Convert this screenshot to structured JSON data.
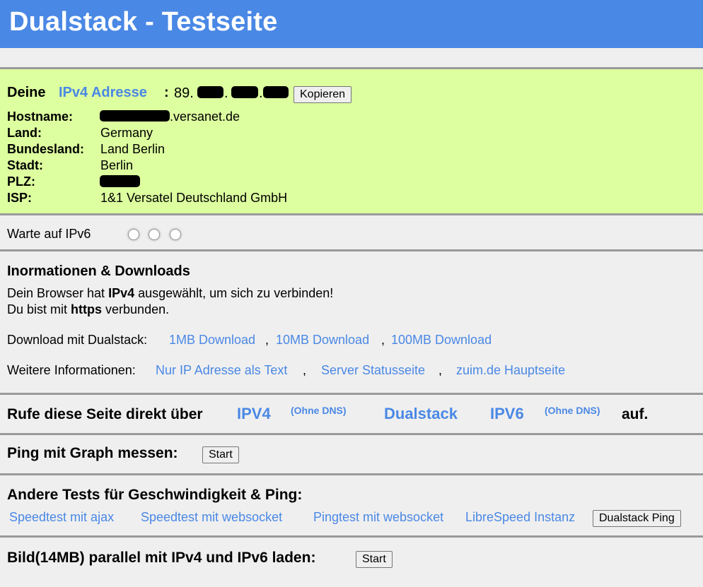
{
  "header": {
    "title": "Dualstack - Testseite"
  },
  "ipv4_box": {
    "lead": "Deine",
    "proto": "IPv4 Adresse",
    "colon": ":",
    "ip_prefix": "89.",
    "ip_dot1": ".",
    "ip_dot2": ".",
    "copy_button": "Kopieren",
    "fields": [
      {
        "label": "Hostname:",
        "value": ".versanet.de"
      },
      {
        "label": "Land:",
        "value": "Germany"
      },
      {
        "label": "Bundesland:",
        "value": "Land Berlin"
      },
      {
        "label": "Stadt:",
        "value": "Berlin"
      },
      {
        "label": "PLZ:",
        "value": ""
      },
      {
        "label": "ISP:",
        "value": "1&1 Versatel Deutschland GmbH"
      }
    ]
  },
  "ipv6_wait": {
    "text": "Warte auf IPv6"
  },
  "info": {
    "title": "Inormationen & Downloads",
    "line1_a": "Dein Browser hat ",
    "line1_b": "IPv4",
    "line1_c": " ausgewählt, um sich zu verbinden!",
    "line2_a": "Du bist mit ",
    "line2_b": "https",
    "line2_c": " verbunden.",
    "download_label": "Download mit Dualstack:",
    "downloads": [
      "1MB Download",
      "10MB Download",
      "100MB Download"
    ],
    "sep": ",",
    "more_label": "Weitere Informationen:",
    "more_links": [
      "Nur IP Adresse als Text",
      "Server Statusseite",
      "zuim.de Hauptseite"
    ]
  },
  "direct": {
    "lead": "Rufe diese Seite direkt über",
    "ipv4": "IPV4",
    "no_dns_1": "(Ohne DNS)",
    "dualstack": "Dualstack",
    "ipv6": "IPV6",
    "no_dns_2": "(Ohne DNS)",
    "tail": "auf."
  },
  "ping": {
    "title": "Ping mit Graph messen:",
    "start_button": "Start"
  },
  "other_tests": {
    "title": "Andere Tests für Geschwindigkeit & Ping:",
    "links": [
      "Speedtest mit ajax",
      "Speedtest mit websocket",
      "Pingtest mit websocket",
      "LibreSpeed Instanz"
    ],
    "dualstack_ping_button": "Dualstack Ping"
  },
  "image_test": {
    "title": "Bild(14MB) parallel mit IPv4 und IPv6 laden:",
    "start_button": "Start"
  }
}
